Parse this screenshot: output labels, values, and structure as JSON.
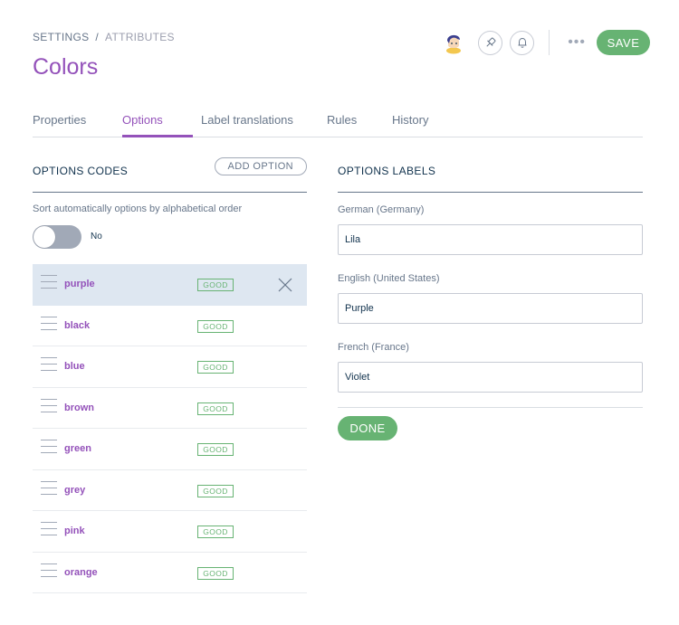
{
  "breadcrumb": {
    "items": [
      "SETTINGS",
      "ATTRIBUTES"
    ],
    "separator": "/"
  },
  "page_title": "Colors",
  "top_actions": {
    "avatar_icon": "user-avatar",
    "buttons": [
      "pin-icon",
      "bell-icon"
    ],
    "more_label": "•••",
    "save_label": "SAVE"
  },
  "tabs": [
    {
      "label": "Properties",
      "active": false
    },
    {
      "label": "Options",
      "active": true
    },
    {
      "label": "Label translations",
      "active": false
    },
    {
      "label": "Rules",
      "active": false
    },
    {
      "label": "History",
      "active": false
    }
  ],
  "options_codes": {
    "title": "OPTIONS CODES",
    "add_label": "ADD OPTION",
    "sort_label": "Sort automatically options by alphabetical order",
    "toggle_state": "No",
    "items": [
      {
        "code": "purple",
        "status": "GOOD",
        "selected": true
      },
      {
        "code": "black",
        "status": "GOOD"
      },
      {
        "code": "blue",
        "status": "GOOD"
      },
      {
        "code": "brown",
        "status": "GOOD"
      },
      {
        "code": "green",
        "status": "GOOD"
      },
      {
        "code": "grey",
        "status": "GOOD"
      },
      {
        "code": "pink",
        "status": "GOOD"
      },
      {
        "code": "orange",
        "status": "GOOD"
      }
    ]
  },
  "options_labels": {
    "title": "OPTIONS LABELS",
    "fields": [
      {
        "label": "German (Germany)",
        "value": "Lila"
      },
      {
        "label": "English (United States)",
        "value": "Purple"
      },
      {
        "label": "French (France)",
        "value": "Violet"
      }
    ],
    "done_label": "DONE"
  },
  "colors": {
    "accent_purple": "#9452ba",
    "good_green": "#67b373",
    "selected_row": "#dee7f1",
    "text_grey": "#67768a"
  }
}
